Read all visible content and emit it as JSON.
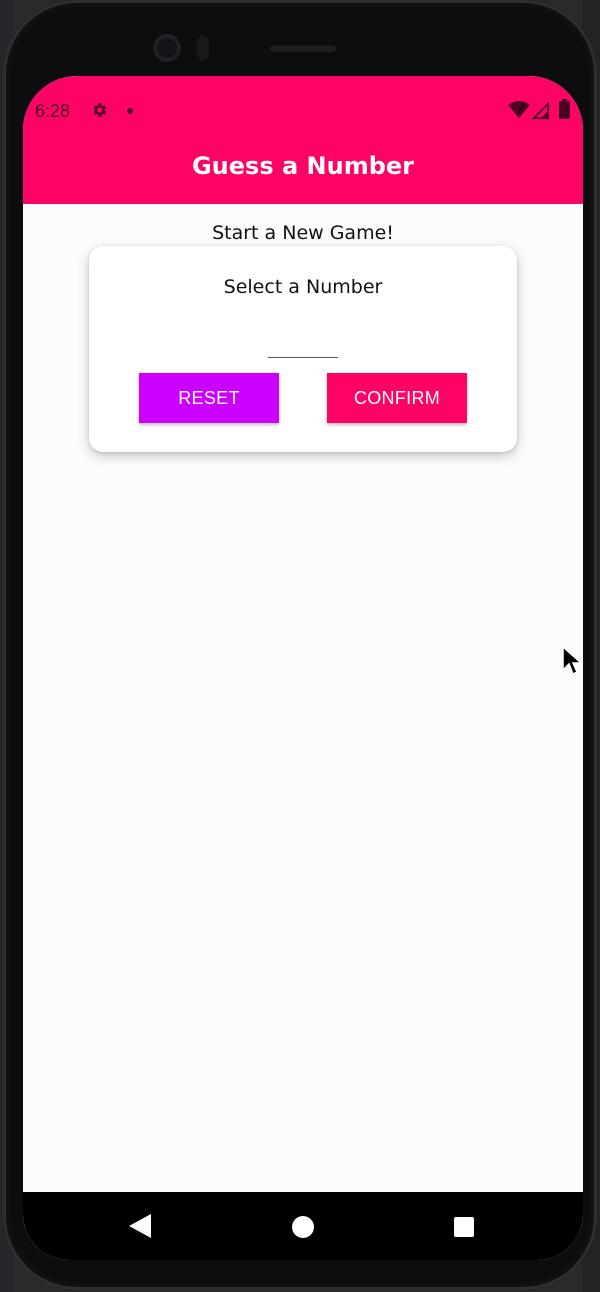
{
  "status_bar": {
    "time": "6:28",
    "icons": [
      "gear-icon",
      "notification-dot-icon",
      "wifi-icon",
      "signal-icon",
      "battery-icon"
    ]
  },
  "app_bar": {
    "title": "Guess a Number"
  },
  "main": {
    "start_title": "Start a New Game!",
    "card": {
      "title": "Select a Number",
      "input_value": "",
      "reset_label": "RESET",
      "confirm_label": "CONFIRM"
    }
  },
  "nav_bar": {
    "icons": [
      "back-icon",
      "home-icon",
      "recents-icon"
    ]
  },
  "colors": {
    "primary": "#ff0266",
    "accent": "#cc00ff"
  }
}
